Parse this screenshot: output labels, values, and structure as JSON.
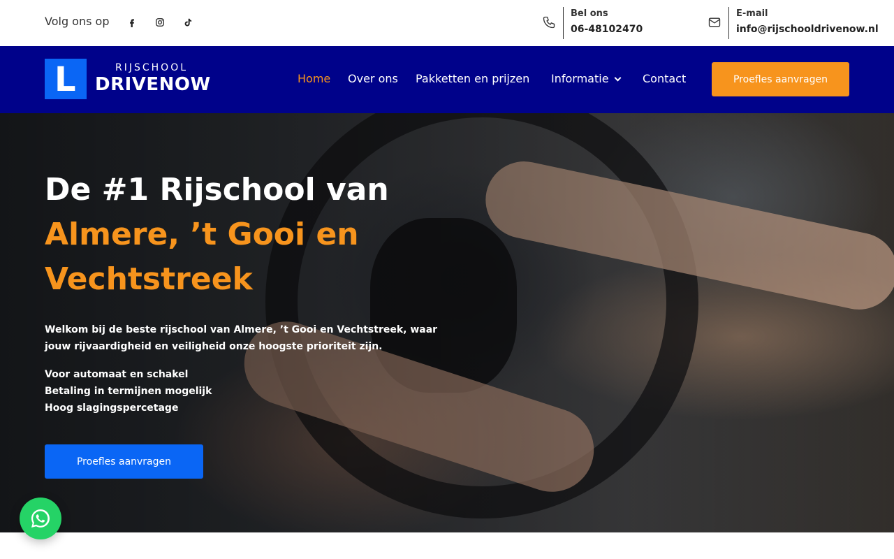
{
  "topbar": {
    "follow_label": "Volg ons op",
    "social": [
      {
        "icon": "facebook-icon"
      },
      {
        "icon": "instagram-icon"
      },
      {
        "icon": "tiktok-icon"
      }
    ],
    "phone": {
      "icon": "phone-icon",
      "label": "Bel ons",
      "value": "06-48102470"
    },
    "email": {
      "icon": "mail-icon",
      "label": "E-mail",
      "value": "info@rijschooldrivenow.nl"
    }
  },
  "nav": {
    "logo": {
      "letter": "L",
      "sub": "RIJSCHOOL",
      "main": "DRIVENOW"
    },
    "items": [
      {
        "label": "Home",
        "active": true
      },
      {
        "label": "Over ons"
      },
      {
        "label": "Pakketten en prijzen"
      },
      {
        "label": "Informatie",
        "dropdown": true
      },
      {
        "label": "Contact"
      }
    ],
    "cta": "Proefles aanvragen"
  },
  "hero": {
    "title_line1": "De #1 Rijschool van",
    "title_line2": "Almere, ’t Gooi en",
    "title_line3": "Vechtstreek",
    "text": "Welkom bij de beste rijschool van Almere, ’t Gooi en Vechtstreek, waar jouw rijvaardigheid en veiligheid onze hoogste prioriteit zijn.",
    "features": [
      "Voor automaat en schakel",
      "Betaling in termijnen mogelijk",
      "Hoog slagingspercetage"
    ],
    "cta": "Proefles aanvragen"
  },
  "colors": {
    "navy": "#00028a",
    "orange": "#f7941d",
    "blue": "#0a66f5",
    "whatsapp": "#25d366"
  }
}
